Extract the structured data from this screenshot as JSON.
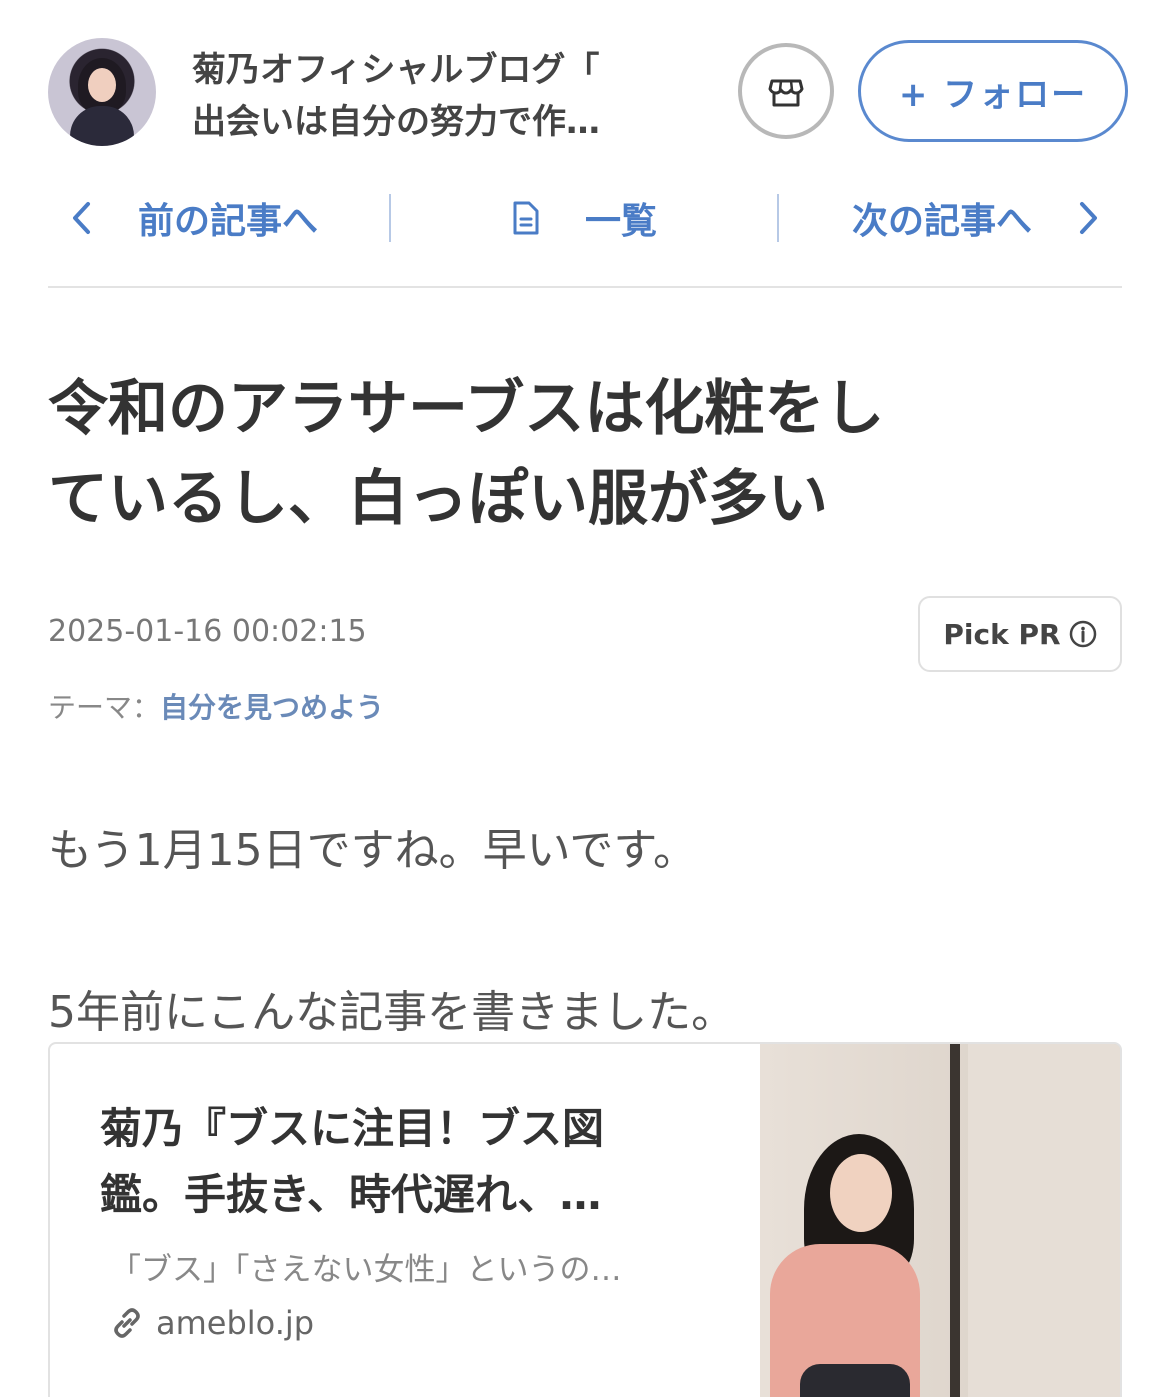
{
  "header": {
    "blog_title_line1": "菊乃オフィシャルブログ「",
    "blog_title_line2": "出会いは自分の努力で作…",
    "follow_label": "+ フォロー",
    "shop_icon": "shop-icon"
  },
  "nav": {
    "prev_label": "前の記事へ",
    "list_label": "一覧",
    "next_label": "次の記事へ"
  },
  "article": {
    "title_line1": "令和のアラサーブスは化粧をし",
    "title_line2": "ているし、白っぽい服が多い",
    "datetime": "2025-01-16 00:02:15",
    "pick_pr_label": "Pick PR",
    "theme_label": "テーマ：",
    "theme_value": "自分を見つめよう",
    "paragraph1": "もう1月15日ですね。早いです。",
    "paragraph2": "5年前にこんな記事を書きました。"
  },
  "link_card": {
    "title_line1": "菊乃『ブスに注目！ブス図",
    "title_line2": "鑑。手抜き、時代遅れ、…",
    "description": "「ブス」「さえない女性」というの…",
    "domain": "ameblo.jp"
  },
  "colors": {
    "accent": "#4a7cc6",
    "text": "#333333",
    "muted": "#777777"
  }
}
